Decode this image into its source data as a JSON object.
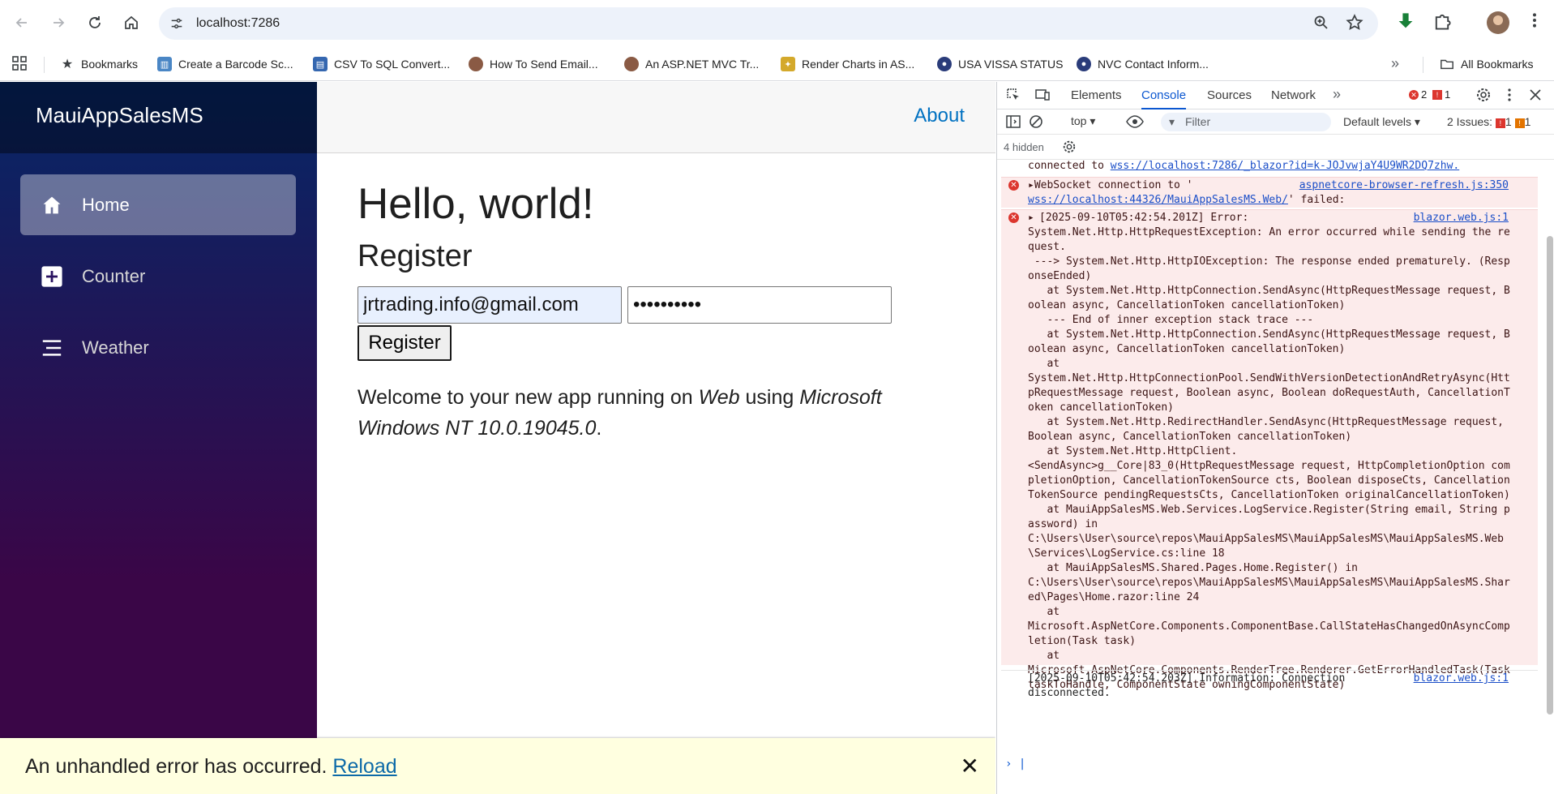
{
  "browser": {
    "url": "localhost:7286",
    "bookmarks": [
      {
        "label": "Bookmarks",
        "icon": "star-icon",
        "color": "#5f6368"
      },
      {
        "label": "Create a Barcode Sc...",
        "icon": "barcode-site-icon",
        "color": "#4a86c5"
      },
      {
        "label": "CSV To SQL Convert...",
        "icon": "csv-site-icon",
        "color": "#3567b0"
      },
      {
        "label": "How To Send Email...",
        "icon": "person-site-icon",
        "color": "#8a5a44"
      },
      {
        "label": "An ASP.NET MVC Tr...",
        "icon": "person-site-icon",
        "color": "#8a5a44"
      },
      {
        "label": "Render Charts in AS...",
        "icon": "chart-site-icon",
        "color": "#d4a92b"
      },
      {
        "label": "USA VISSA STATUS",
        "icon": "seal-site-icon",
        "color": "#2a3c7a"
      },
      {
        "label": "NVC Contact Inform...",
        "icon": "seal-site-icon",
        "color": "#2a3c7a"
      }
    ],
    "all_bookmarks": "All Bookmarks"
  },
  "app": {
    "brand": "MauiAppSalesMS",
    "nav": [
      {
        "label": "Home",
        "icon": "home-icon",
        "active": true
      },
      {
        "label": "Counter",
        "icon": "plus-icon",
        "active": false
      },
      {
        "label": "Weather",
        "icon": "list-icon",
        "active": false
      }
    ],
    "about": "About",
    "hello": "Hello, world!",
    "register_heading": "Register",
    "email_value": "jrtrading.info@gmail.com",
    "password_value": "••••••••••",
    "register_button": "Register",
    "welcome_prefix": "Welcome to your new app running on ",
    "welcome_platform": "Web",
    "welcome_mid": " using ",
    "welcome_os": "Microsoft Windows NT 10.0.19045.0",
    "welcome_suffix": ".",
    "error_text": "An unhandled error has occurred.",
    "error_reload": "Reload",
    "error_close": "✕"
  },
  "devtools": {
    "tabs": [
      "Elements",
      "Console",
      "Sources",
      "Network"
    ],
    "active_tab": "Console",
    "error_count": "2",
    "issue_count": "1",
    "context": "top",
    "filter_placeholder": "Filter",
    "levels": "Default levels",
    "issues_label": "2 Issues:",
    "issues_err": "1",
    "issues_warn": "1",
    "hidden": "4 hidden",
    "messages": {
      "connected_prefix": "connected to ",
      "connected_link": "wss://localhost:7286/_blazor?id=k-JOJvwjaY4U9WR2DQ7zhw.",
      "ws_text": "WebSocket connection to '",
      "ws_link": "wss://localhost:44326/MauiAppSalesMS.Web/",
      "ws_tail": "' failed:",
      "ws_source": "aspnetcore-browser-refresh.js:350",
      "err_source": "blazor.web.js:1",
      "err_text": "[2025-09-10T05:42:54.201Z] Error:\nSystem.Net.Http.HttpRequestException: An error occurred while sending the request.\n ---> System.Net.Http.HttpIOException: The response ended prematurely. (ResponseEnded)\n   at System.Net.Http.HttpConnection.SendAsync(HttpRequestMessage request, Boolean async, CancellationToken cancellationToken)\n   --- End of inner exception stack trace ---\n   at System.Net.Http.HttpConnection.SendAsync(HttpRequestMessage request, Boolean async, CancellationToken cancellationToken)\n   at\nSystem.Net.Http.HttpConnectionPool.SendWithVersionDetectionAndRetryAsync(HttpRequestMessage request, Boolean async, Boolean doRequestAuth, CancellationToken cancellationToken)\n   at System.Net.Http.RedirectHandler.SendAsync(HttpRequestMessage request, Boolean async, CancellationToken cancellationToken)\n   at System.Net.Http.HttpClient.\n<SendAsync>g__Core|83_0(HttpRequestMessage request, HttpCompletionOption completionOption, CancellationTokenSource cts, Boolean disposeCts, CancellationTokenSource pendingRequestsCts, CancellationToken originalCancellationToken)\n   at MauiAppSalesMS.Web.Services.LogService.Register(String email, String password) in\nC:\\Users\\User\\source\\repos\\MauiAppSalesMS\\MauiAppSalesMS\\MauiAppSalesMS.Web\\Services\\LogService.cs:line 18\n   at MauiAppSalesMS.Shared.Pages.Home.Register() in\nC:\\Users\\User\\source\\repos\\MauiAppSalesMS\\MauiAppSalesMS\\MauiAppSalesMS.Shared\\Pages\\Home.razor:line 24\n   at\nMicrosoft.AspNetCore.Components.ComponentBase.CallStateHasChangedOnAsyncCompletion(Task task)\n   at\nMicrosoft.AspNetCore.Components.RenderTree.Renderer.GetErrorHandledTask(Task taskToHandle, ComponentState owningComponentState)",
      "info_text": "[2025-09-10T05:42:54.203Z] Information: Connection\ndisconnected.",
      "info_source": "blazor.web.js:1"
    }
  }
}
